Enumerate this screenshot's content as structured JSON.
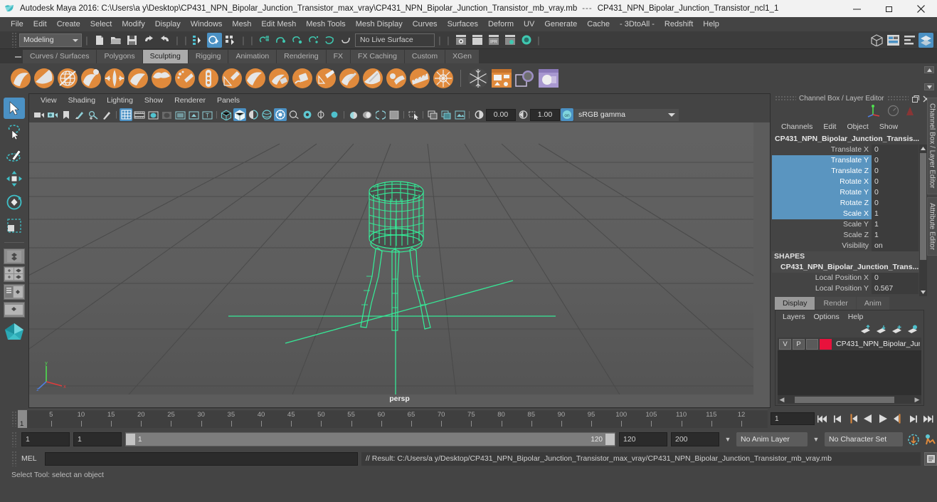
{
  "titlebar": {
    "app_title": "Autodesk Maya 2016: C:\\Users\\a y\\Desktop\\CP431_NPN_Bipolar_Junction_Transistor_max_vray\\CP431_NPN_Bipolar_Junction_Transistor_mb_vray.mb",
    "separator": "---",
    "sub_title": "CP431_NPN_Bipolar_Junction_Transistor_ncl1_1",
    "minimize": "minimize-icon",
    "maximize": "maximize-icon",
    "close": "close-icon"
  },
  "menubar": {
    "items": [
      "File",
      "Edit",
      "Create",
      "Select",
      "Modify",
      "Display",
      "Windows",
      "Mesh",
      "Edit Mesh",
      "Mesh Tools",
      "Mesh Display",
      "Curves",
      "Surfaces",
      "Deform",
      "UV",
      "Generate",
      "Cache",
      "- 3DtoAll -",
      "Redshift",
      "Help"
    ]
  },
  "statusline": {
    "menuset": "Modeling",
    "live_surface": "No Live Surface",
    "icons": [
      "new-scene-icon",
      "open-scene-icon",
      "save-scene-icon",
      "undo-icon",
      "redo-icon",
      "select-by-hierarchy-icon",
      "select-by-object-icon",
      "select-by-component-icon",
      "snap-to-grid-icon",
      "snap-to-curve-icon",
      "snap-to-point-icon",
      "snap-to-projected-center-icon",
      "snap-to-view-plane-icon",
      "make-live-icon",
      "render-current-frame-icon",
      "render-sequence-icon",
      "ipr-render-icon",
      "render-settings-icon",
      "hypershade-icon"
    ],
    "right_icons": [
      "show-hide-modeling-toolkit-icon",
      "attribute-editor-icon",
      "tool-settings-icon",
      "channel-box-icon"
    ]
  },
  "shelf": {
    "tabs": [
      "Curves / Surfaces",
      "Polygons",
      "Sculpting",
      "Rigging",
      "Animation",
      "Rendering",
      "FX",
      "FX Caching",
      "Custom",
      "XGen"
    ],
    "active_tab": "Sculpting",
    "tools": [
      {
        "name": "sculpt-tool-icon",
        "color": "#e08a3c"
      },
      {
        "name": "smooth-tool-icon",
        "color": "#e08a3c"
      },
      {
        "name": "relax-tool-icon",
        "color": "#e08a3c"
      },
      {
        "name": "grab-tool-icon",
        "color": "#e08a3c"
      },
      {
        "name": "pinch-tool-icon",
        "color": "#e08a3c"
      },
      {
        "name": "flatten-tool-icon",
        "color": "#e08a3c"
      },
      {
        "name": "foamy-tool-icon",
        "color": "#e08a3c"
      },
      {
        "name": "spray-tool-icon",
        "color": "#e08a3c"
      },
      {
        "name": "repeat-tool-icon",
        "color": "#e08a3c"
      },
      {
        "name": "imprint-tool-icon",
        "color": "#e08a3c"
      },
      {
        "name": "wax-tool-icon",
        "color": "#e08a3c"
      },
      {
        "name": "scrape-tool-icon",
        "color": "#e08a3c"
      },
      {
        "name": "fill-tool-icon",
        "color": "#e08a3c"
      },
      {
        "name": "knife-tool-icon",
        "color": "#e08a3c"
      },
      {
        "name": "smear-tool-icon",
        "color": "#e08a3c"
      },
      {
        "name": "bulge-tool-icon",
        "color": "#e08a3c"
      },
      {
        "name": "amplify-tool-icon",
        "color": "#e08a3c"
      },
      {
        "name": "freeze-tool-icon",
        "color": "#e08a3c"
      },
      {
        "name": "convert-tool-icon",
        "color": "#e08a3c"
      }
    ],
    "extra_tools": [
      "snowflake-icon",
      "sculpt-layers-icon",
      "mirror-icon",
      "clone-target-icon"
    ]
  },
  "panel": {
    "menus": [
      "View",
      "Shading",
      "Lighting",
      "Show",
      "Renderer",
      "Panels"
    ],
    "exposure": "0.00",
    "gamma": "1.00",
    "color_profile": "sRGB gamma",
    "label": "persp"
  },
  "toolbox": {
    "tools": [
      "select-tool-icon",
      "lasso-select-tool-icon",
      "paint-select-tool-icon",
      "move-tool-icon",
      "rotate-tool-icon",
      "scale-tool-icon"
    ],
    "active": "select-tool-icon",
    "layouts": [
      "single-perspective-layout-icon",
      "four-view-layout-icon",
      "outliner-persp-layout-icon",
      "persp-graph-layout-icon",
      "maya-logo-icon"
    ]
  },
  "channelbox": {
    "panel_title": "Channel Box / Layer Editor",
    "menus": [
      "Channels",
      "Edit",
      "Object",
      "Show"
    ],
    "node_name": "CP431_NPN_Bipolar_Junction_Transis...",
    "attributes": [
      {
        "label": "Translate X",
        "value": "0",
        "selected": false
      },
      {
        "label": "Translate Y",
        "value": "0",
        "selected": true
      },
      {
        "label": "Translate Z",
        "value": "0",
        "selected": true
      },
      {
        "label": "Rotate X",
        "value": "0",
        "selected": true
      },
      {
        "label": "Rotate Y",
        "value": "0",
        "selected": true
      },
      {
        "label": "Rotate Z",
        "value": "0",
        "selected": true
      },
      {
        "label": "Scale X",
        "value": "1",
        "selected": true
      },
      {
        "label": "Scale Y",
        "value": "1",
        "selected": false
      },
      {
        "label": "Scale Z",
        "value": "1",
        "selected": false
      },
      {
        "label": "Visibility",
        "value": "on",
        "selected": false
      }
    ],
    "shapes_header": "SHAPES",
    "shape_name": "CP431_NPN_Bipolar_Junction_Trans...",
    "shape_attributes": [
      {
        "label": "Local Position X",
        "value": "0",
        "selected": false
      },
      {
        "label": "Local Position Y",
        "value": "0.567",
        "selected": false
      }
    ]
  },
  "layereditor": {
    "tabs": [
      "Display",
      "Render",
      "Anim"
    ],
    "active_tab": "Display",
    "menus": [
      "Layers",
      "Options",
      "Help"
    ],
    "buttons": [
      "move-layer-up-icon",
      "move-layer-down-icon",
      "new-layer-icon",
      "new-layer-from-selected-icon"
    ],
    "layers": [
      {
        "visibility": "V",
        "playback": "P",
        "type": "",
        "color": "#e8123c",
        "name": "CP431_NPN_Bipolar_Junc"
      }
    ]
  },
  "right_tabs": [
    "Channel Box / Layer Editor",
    "Attribute Editor"
  ],
  "timeslider": {
    "start": 1,
    "end": 120,
    "current": "1",
    "tick_labels": [
      "5",
      "10",
      "15",
      "20",
      "25",
      "30",
      "35",
      "40",
      "45",
      "50",
      "55",
      "60",
      "65",
      "70",
      "75",
      "80",
      "85",
      "90",
      "95",
      "100",
      "105",
      "110",
      "115",
      "12"
    ],
    "playback_buttons": [
      "go-to-start-icon",
      "step-back-frame-icon",
      "step-back-key-icon",
      "play-backwards-icon",
      "play-forwards-icon",
      "step-forward-key-icon",
      "step-forward-frame-icon",
      "go-to-end-icon"
    ]
  },
  "rangeslider": {
    "anim_start": "1",
    "range_start": "1",
    "bar_start": "1",
    "bar_end": "120",
    "range_end": "120",
    "anim_end": "200",
    "anim_layer": "No Anim Layer",
    "character_set": "No Character Set",
    "auto_key_icon": "auto-keyframe-icon",
    "anim_prefs_icon": "animation-preferences-icon"
  },
  "commandline": {
    "language": "MEL",
    "input_value": "",
    "result": "// Result: C:/Users/a y/Desktop/CP431_NPN_Bipolar_Junction_Transistor_max_vray/CP431_NPN_Bipolar_Junction_Transistor_mb_vray.mb",
    "script_editor_icon": "script-editor-icon"
  },
  "helpline": {
    "text": "Select Tool: select an object"
  },
  "colors": {
    "accent_blue": "#4b91c4",
    "mesh_green": "#34f09a",
    "shelf_orange": "#e08a3c",
    "layer_red": "#e8123c"
  }
}
